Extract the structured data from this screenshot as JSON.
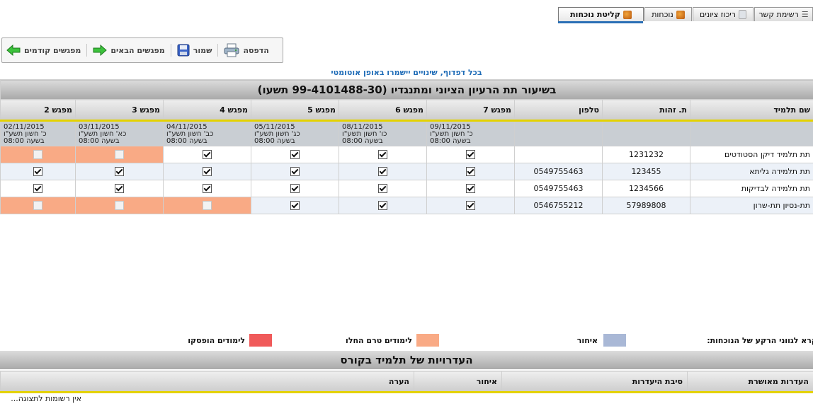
{
  "tabs": [
    {
      "label": "רשימת קשר",
      "icon": "list-icon",
      "active": false
    },
    {
      "label": "ריכוז ציונים",
      "icon": "document-icon",
      "active": false
    },
    {
      "label": "נוכחות",
      "icon": "people-icon",
      "active": false
    },
    {
      "label": "קליטת נוכחות",
      "icon": "people-icon",
      "active": true
    }
  ],
  "toolbar": {
    "print_label": "הדפסה",
    "save_label": "שמור",
    "next_label": "מפגשים הבאים",
    "prev_label": "מפגשים קודמים"
  },
  "autosave_notice": "בכל דפדוף, שינויים יישמרו באופן אוטומטי",
  "grid": {
    "title": "בשיעור תת הרעיון הציוני ומתנגדיו (99-4101488-30    תשעו)",
    "columns": [
      "שם תלמיד",
      "ת. זהות",
      "טלפון",
      "מפגש 7",
      "מפגש 6",
      "מפגש 5",
      "מפגש 4",
      "מפגש 3",
      "מפגש 2"
    ],
    "sessions": [
      {
        "date": "09/11/2015",
        "hebrew": "כ' חשון תשע\"ו",
        "time": "בשעה 08:00"
      },
      {
        "date": "08/11/2015",
        "hebrew": "כו' חשון תשע\"ו",
        "time": "בשעה 08:00"
      },
      {
        "date": "05/11/2015",
        "hebrew": "כג' חשון תשע\"ו",
        "time": "בשעה 08:00"
      },
      {
        "date": "04/11/2015",
        "hebrew": "כב' חשון תשע\"ו",
        "time": "בשעה 08:00"
      },
      {
        "date": "03/11/2015",
        "hebrew": "כא' חשון תשע\"ו",
        "time": "בשעה 08:00"
      },
      {
        "date": "02/11/2015",
        "hebrew": "כ' חשון תשע\"ו",
        "time": "בשעה 08:00"
      }
    ],
    "students": [
      {
        "name": "תת תלמיד דיקן הסטודטים",
        "id": "1231232",
        "phone": "",
        "marks": [
          "on",
          "on",
          "on",
          "on",
          "dis-orange",
          "dis-orange"
        ]
      },
      {
        "name": "תת תלמידה גליתא",
        "id": "123455",
        "phone": "0549755463",
        "marks": [
          "on",
          "on",
          "on",
          "on",
          "on",
          "on"
        ]
      },
      {
        "name": "תת תלמידה לבדיקות",
        "id": "1234566",
        "phone": "0549755463",
        "marks": [
          "on",
          "on",
          "on",
          "on",
          "on",
          "on"
        ]
      },
      {
        "name": "תת-נסיון תת-שרון",
        "id": "57989808",
        "phone": "0546755212",
        "marks": [
          "on",
          "on",
          "on",
          "dis-orange",
          "dis-orange",
          "dis-orange"
        ]
      }
    ]
  },
  "legend": {
    "intro": "קרא לגווני הרקע של הנוכחות:",
    "late": "איחור",
    "not_started": "לימודים טרם החלו",
    "stopped": "לימודים הופסקו",
    "colors": {
      "late": "#a9b8d6",
      "not_started": "#f9aa85",
      "stopped": "#f05a5a"
    }
  },
  "absences": {
    "title": "העדרויות של תלמיד בקורס",
    "columns": [
      "העדרות מאושרת",
      "סיבת היעדרות",
      "איחור",
      "הערה"
    ],
    "empty_message": "אין רשומות לתצוגה..."
  }
}
